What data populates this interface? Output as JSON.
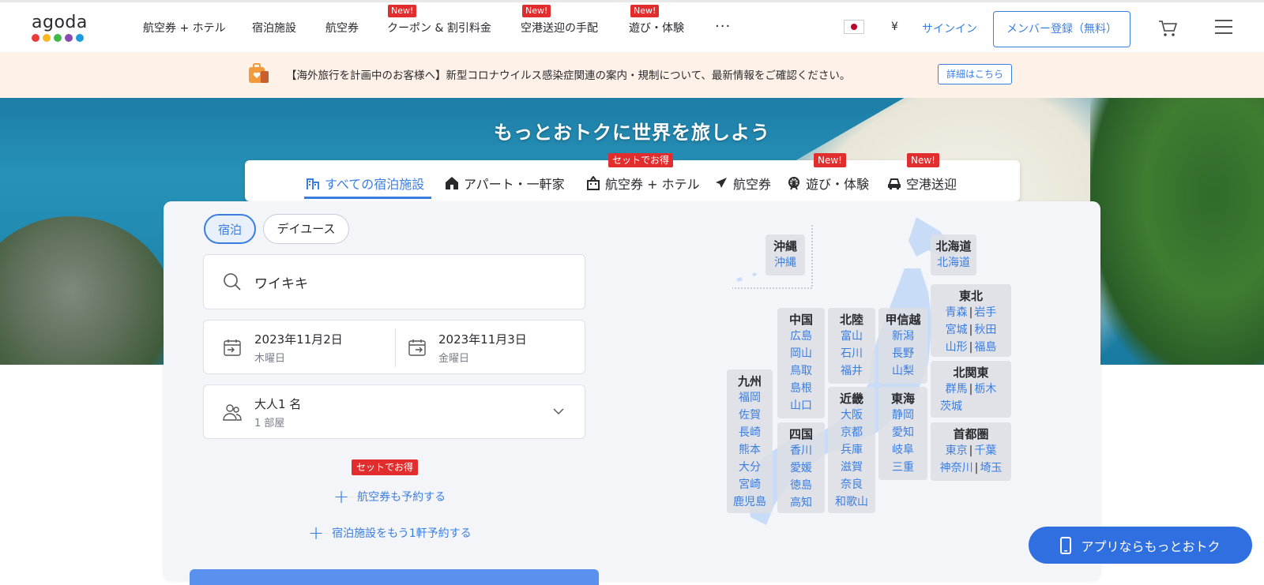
{
  "header": {
    "logo": "agoda",
    "logo_dot_colors": [
      "#ec3b3b",
      "#f7b820",
      "#3fb948",
      "#8c47b3",
      "#1e9ae0"
    ],
    "nav": [
      {
        "label": "航空券 + ホテル",
        "badge": ""
      },
      {
        "label": "宿泊施設",
        "badge": ""
      },
      {
        "label": "航空券",
        "badge": ""
      },
      {
        "label": "クーポン & 割引料金",
        "badge": "New!"
      },
      {
        "label": "空港送迎の手配",
        "badge": "New!"
      },
      {
        "label": "遊び・体験",
        "badge": "New!"
      }
    ],
    "more": "···",
    "currency": "¥",
    "signin": "サインイン",
    "register": "メンバー登録（無料）"
  },
  "notice": {
    "text": "【海外旅行を計画中のお客様へ】新型コロナウイルス感染症関連の案内・規制について、最新情報をご確認ください。",
    "link": "詳細はこちら"
  },
  "hero": {
    "title": "もっとおトクに世界を旅しよう"
  },
  "tabs": [
    {
      "label": "すべての宿泊施設",
      "icon": "building-icon",
      "badge": ""
    },
    {
      "label": "アパート・一軒家",
      "icon": "house-icon",
      "badge": ""
    },
    {
      "label": "航空券 + ホテル",
      "icon": "hotel-flight-icon",
      "badge": "セットでお得"
    },
    {
      "label": "航空券",
      "icon": "plane-icon",
      "badge": ""
    },
    {
      "label": "遊び・体験",
      "icon": "ferris-wheel-icon",
      "badge": "New!"
    },
    {
      "label": "空港送迎",
      "icon": "car-icon",
      "badge": "New!"
    }
  ],
  "search": {
    "pill_stay": "宿泊",
    "pill_dayuse": "デイユース",
    "destination": "ワイキキ",
    "checkin_date": "2023年11月2日",
    "checkin_day": "木曜日",
    "checkout_date": "2023年11月3日",
    "checkout_day": "金曜日",
    "guests": "大人1 名",
    "rooms": "1 部屋",
    "set_badge": "セットでお得",
    "add_flight": "航空券も予約する",
    "add_hotel": "宿泊施設をもう1軒予約する"
  },
  "map": {
    "okinawa": {
      "name": "沖縄",
      "prefs": [
        "沖縄"
      ]
    },
    "hokkaido": {
      "name": "北海道",
      "prefs": [
        "北海道"
      ]
    },
    "tohoku": {
      "name": "東北",
      "rows": [
        [
          "青森",
          "岩手"
        ],
        [
          "宮城",
          "秋田"
        ],
        [
          "山形",
          "福島"
        ]
      ]
    },
    "chugoku": {
      "name": "中国",
      "prefs": [
        "広島",
        "岡山",
        "鳥取",
        "島根",
        "山口"
      ]
    },
    "hokuriku": {
      "name": "北陸",
      "prefs": [
        "富山",
        "石川",
        "福井"
      ]
    },
    "koshinetsu": {
      "name": "甲信越",
      "prefs": [
        "新潟",
        "長野",
        "山梨"
      ]
    },
    "kitakanto": {
      "name": "北関東",
      "rows": [
        [
          "群馬",
          "栃木"
        ],
        [
          "茨城"
        ]
      ]
    },
    "kyushu": {
      "name": "九州",
      "prefs": [
        "福岡",
        "佐賀",
        "長崎",
        "熊本",
        "大分",
        "宮崎",
        "鹿児島"
      ]
    },
    "kinki": {
      "name": "近畿",
      "prefs": [
        "大阪",
        "京都",
        "兵庫",
        "滋賀",
        "奈良",
        "和歌山"
      ]
    },
    "tokai": {
      "name": "東海",
      "prefs": [
        "静岡",
        "愛知",
        "岐阜",
        "三重"
      ]
    },
    "shikoku": {
      "name": "四国",
      "prefs": [
        "香川",
        "愛媛",
        "徳島",
        "高知"
      ]
    },
    "shutoken": {
      "name": "首都圏",
      "rows": [
        [
          "東京",
          "千葉"
        ],
        [
          "神奈川",
          "埼玉"
        ]
      ]
    }
  },
  "app_button": "アプリならもっとおトク",
  "colors": {
    "accent": "#3a7ee0",
    "badge": "#e12d2d",
    "notice_bg": "#fdf1e8"
  }
}
